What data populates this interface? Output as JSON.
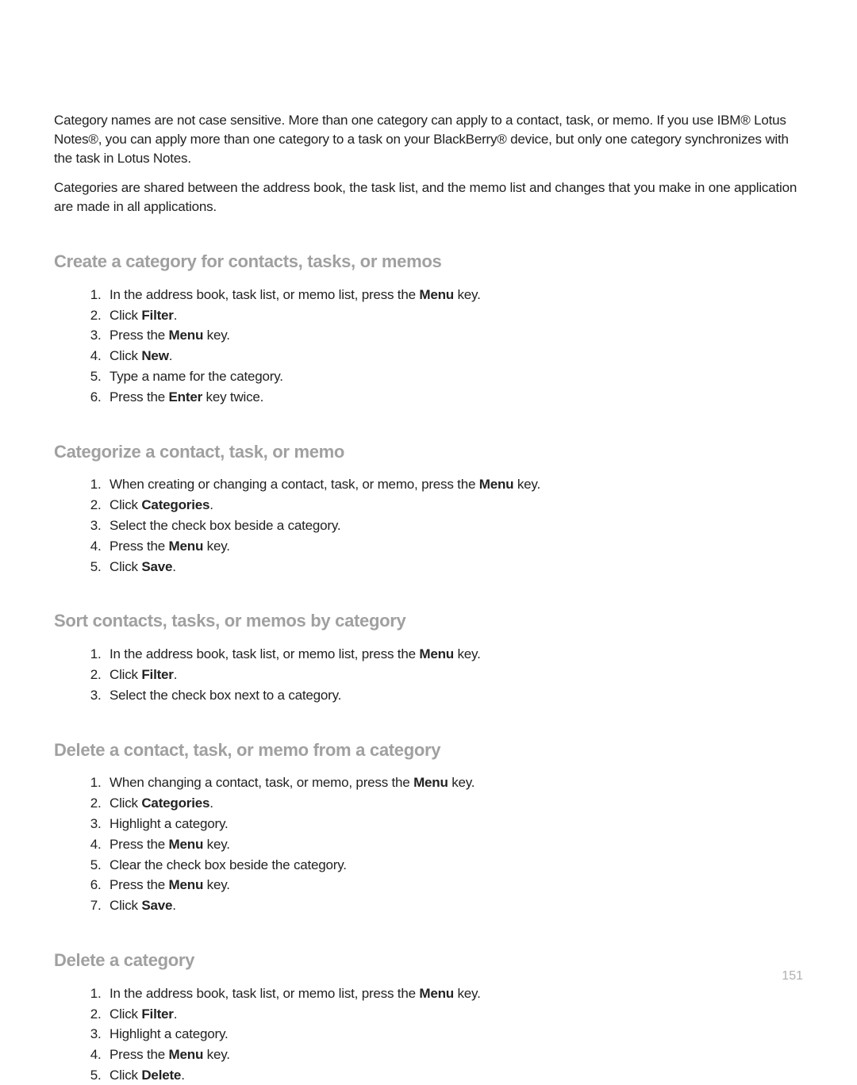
{
  "intro": {
    "p1_pre": "Category names are not case sensitive. More than one category can apply to a contact, task, or memo. If you use IBM",
    "p1_mid": " Lotus Notes",
    "p1_post": ", you can apply more than one category to a task on your BlackBerry",
    "p1_end": " device, but only one category synchronizes with the task in Lotus Notes.",
    "p2": "Categories are shared between the address book, the task list, and the memo list and changes that you make in one application are made in all applications."
  },
  "sections": {
    "s1": {
      "title": "Create a category for contacts, tasks, or memos",
      "i1a": "In the address book, task list, or memo list, press the ",
      "i1b": "Menu",
      "i1c": " key.",
      "i2a": "Click ",
      "i2b": "Filter",
      "i2c": ".",
      "i3a": "Press the ",
      "i3b": "Menu",
      "i3c": " key.",
      "i4a": "Click ",
      "i4b": "New",
      "i4c": ".",
      "i5": "Type a name for the category.",
      "i6a": "Press the ",
      "i6b": "Enter",
      "i6c": " key twice."
    },
    "s2": {
      "title": "Categorize a contact, task, or memo",
      "i1a": "When creating or changing a contact, task, or memo, press the ",
      "i1b": "Menu",
      "i1c": " key.",
      "i2a": "Click ",
      "i2b": "Categories",
      "i2c": ".",
      "i3": "Select the check box beside a category.",
      "i4a": "Press the ",
      "i4b": "Menu",
      "i4c": " key.",
      "i5a": "Click ",
      "i5b": "Save",
      "i5c": "."
    },
    "s3": {
      "title": "Sort contacts, tasks, or memos by category",
      "i1a": "In the address book, task list, or memo list, press the ",
      "i1b": "Menu",
      "i1c": " key.",
      "i2a": "Click ",
      "i2b": "Filter",
      "i2c": ".",
      "i3": "Select the check box next to a category."
    },
    "s4": {
      "title": "Delete a contact, task, or memo from a category",
      "i1a": "When changing a contact, task, or memo, press the ",
      "i1b": "Menu",
      "i1c": " key.",
      "i2a": "Click ",
      "i2b": "Categories",
      "i2c": ".",
      "i3": "Highlight a category.",
      "i4a": "Press the ",
      "i4b": "Menu",
      "i4c": " key.",
      "i5": "Clear the check box beside the category.",
      "i6a": "Press the ",
      "i6b": "Menu",
      "i6c": " key.",
      "i7a": "Click ",
      "i7b": "Save",
      "i7c": "."
    },
    "s5": {
      "title": "Delete a category",
      "i1a": "In the address book, task list, or memo list, press the ",
      "i1b": "Menu",
      "i1c": " key.",
      "i2a": "Click ",
      "i2b": "Filter",
      "i2c": ".",
      "i3": "Highlight a category.",
      "i4a": "Press the ",
      "i4b": "Menu",
      "i4c": " key.",
      "i5a": "Click ",
      "i5b": "Delete",
      "i5c": "."
    }
  },
  "page_number": "151",
  "reg": "®"
}
